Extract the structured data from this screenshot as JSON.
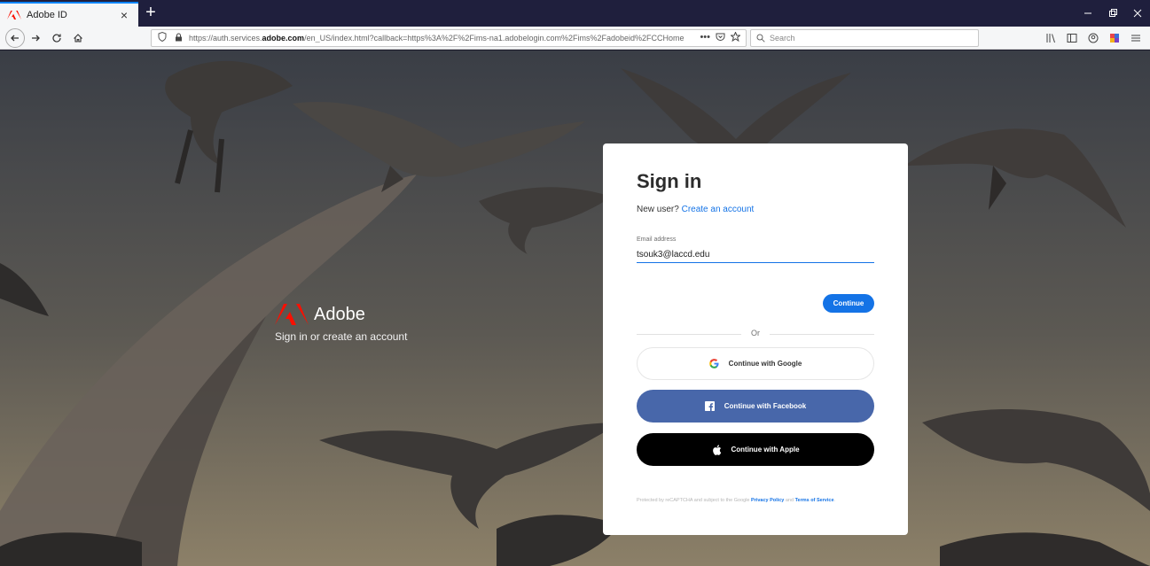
{
  "browser": {
    "tab_title": "Adobe ID",
    "tab_close": "×",
    "new_tab": "+",
    "url_prefix": "https://auth.services.",
    "url_domain": "adobe.com",
    "url_rest": "/en_US/index.html?callback=https%3A%2F%2Fims-na1.adobelogin.com%2Fims%2Fadobeid%2FCCHome",
    "url_more": "•••",
    "search_placeholder": "Search"
  },
  "brand": {
    "name": "Adobe",
    "tagline": "Sign in or create an account"
  },
  "signin": {
    "title": "Sign in",
    "new_user_text": "New user?",
    "create_account_link": "Create an account",
    "email_label": "Email address",
    "email_value": "tsouk3@laccd.edu",
    "continue_label": "Continue",
    "or_label": "Or",
    "google_label": "Continue with Google",
    "facebook_label": "Continue with Facebook",
    "apple_label": "Continue with Apple",
    "legal_prefix": "Protected by reCAPTCHA and subject to the Google",
    "privacy_link": "Privacy Policy",
    "legal_and": "and",
    "terms_link": "Terms of Service",
    "legal_suffix": "."
  },
  "colors": {
    "accent": "#1473e6",
    "facebook": "#4867aa",
    "apple": "#000000",
    "adobe_red": "#fa0f00",
    "tabbar": "#1f1f3d"
  },
  "icons": [
    "adobe-logo-icon",
    "back-icon",
    "forward-icon",
    "reload-icon",
    "home-icon",
    "shield-icon",
    "lock-icon",
    "pocket-icon",
    "star-icon",
    "search-icon",
    "library-icon",
    "sidebar-icon",
    "account-icon",
    "extension-icon",
    "menu-icon",
    "google-icon",
    "facebook-icon",
    "apple-icon",
    "minimize-icon",
    "maximize-icon",
    "close-icon"
  ]
}
